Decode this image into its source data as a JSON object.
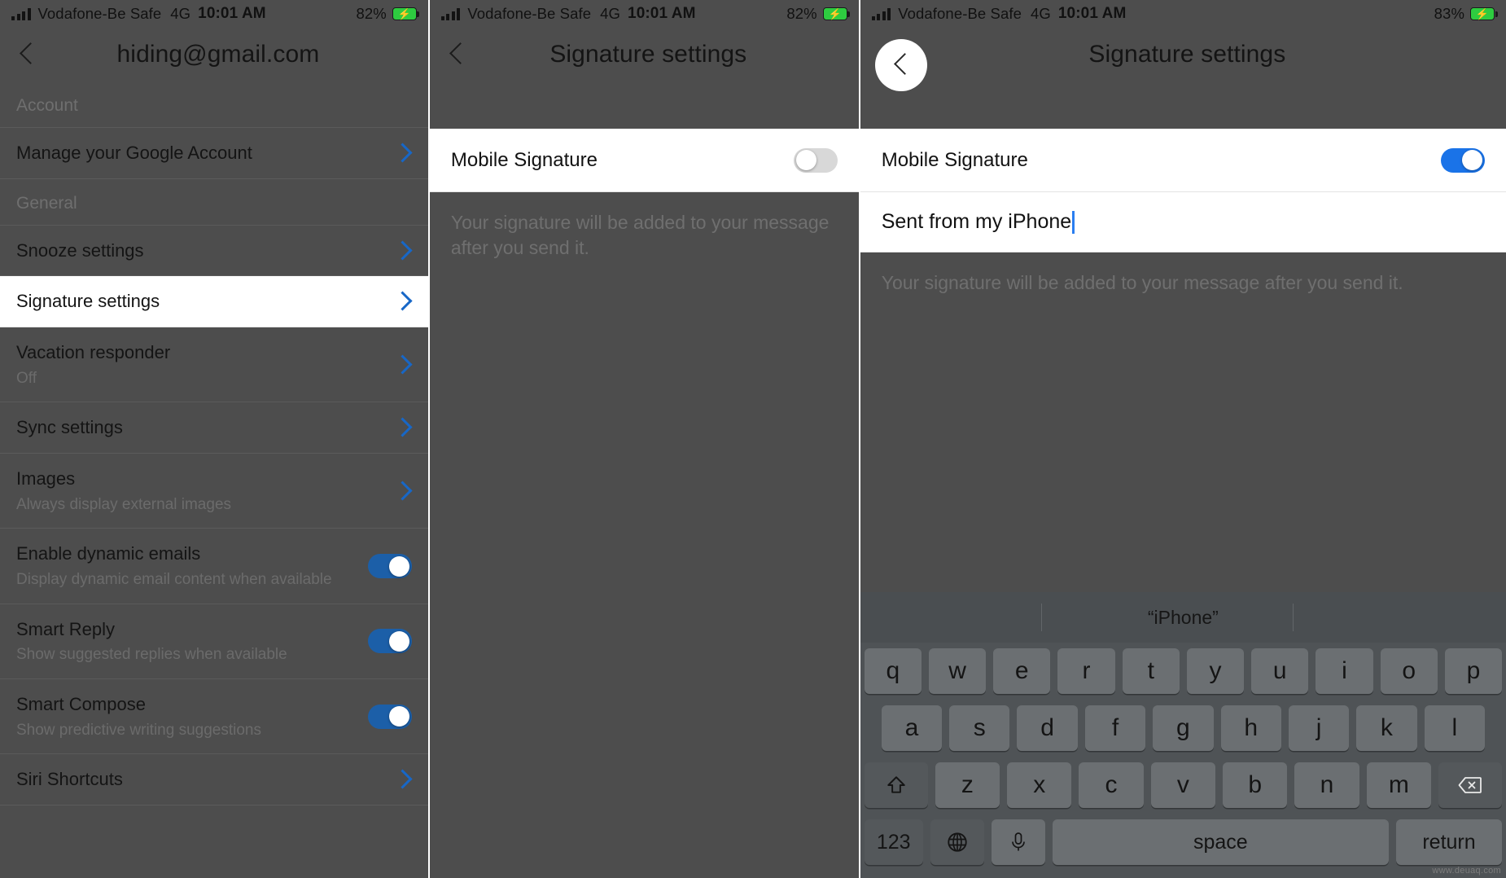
{
  "status_bar": {
    "carrier": "Vodafone-Be Safe",
    "network": "4G",
    "time": "10:01 AM",
    "battery_1": "82%",
    "battery_2": "82%",
    "battery_3": "83%",
    "signal_icon": "signal-bars-icon",
    "battery_icon": "battery-charging-icon"
  },
  "panel1": {
    "nav": {
      "back_icon": "chevron-left-icon",
      "title": "hiding@gmail.com"
    },
    "sections": [
      {
        "header": "Account",
        "rows": [
          {
            "title": "Manage your Google Account",
            "sub": "",
            "accessory": "chevron"
          }
        ]
      },
      {
        "header": "General",
        "rows": [
          {
            "title": "Snooze settings",
            "sub": "",
            "accessory": "chevron"
          },
          {
            "title": "Signature settings",
            "sub": "",
            "accessory": "chevron",
            "highlight": true
          },
          {
            "title": "Vacation responder",
            "sub": "Off",
            "accessory": "chevron"
          },
          {
            "title": "Sync settings",
            "sub": "",
            "accessory": "chevron"
          },
          {
            "title": "Images",
            "sub": "Always display external images",
            "accessory": "chevron"
          },
          {
            "title": "Enable dynamic emails",
            "sub": "Display dynamic email content when available",
            "accessory": "toggle-on"
          },
          {
            "title": "Smart Reply",
            "sub": "Show suggested replies when available",
            "accessory": "toggle-on"
          },
          {
            "title": "Smart Compose",
            "sub": "Show predictive writing suggestions",
            "accessory": "toggle-on"
          },
          {
            "title": "Siri Shortcuts",
            "sub": "",
            "accessory": "chevron"
          }
        ]
      }
    ]
  },
  "panel2": {
    "nav": {
      "back_icon": "chevron-left-icon",
      "title": "Signature settings"
    },
    "mobile_signature_label": "Mobile Signature",
    "toggle_state": "off",
    "note": "Your signature will be added to your message after you send it."
  },
  "panel3": {
    "nav": {
      "back_icon": "chevron-left-icon",
      "title": "Signature settings",
      "back_highlighted": true
    },
    "mobile_signature_label": "Mobile Signature",
    "toggle_state": "on",
    "signature_value": "Sent from my iPhone",
    "note": "Your signature will be added to your message after you send it.",
    "keyboard": {
      "suggestion": "“iPhone”",
      "row1": [
        "q",
        "w",
        "e",
        "r",
        "t",
        "y",
        "u",
        "i",
        "o",
        "p"
      ],
      "row2": [
        "a",
        "s",
        "d",
        "f",
        "g",
        "h",
        "j",
        "k",
        "l"
      ],
      "row3_shift_icon": "shift-arrow-icon",
      "row3": [
        "z",
        "x",
        "c",
        "v",
        "b",
        "n",
        "m"
      ],
      "row3_backspace_icon": "backspace-icon",
      "numbers_key": "123",
      "globe_icon": "globe-icon",
      "mic_icon": "microphone-icon",
      "space_key": "space",
      "return_key": "return"
    }
  },
  "colors": {
    "accent_blue": "#1a73e8",
    "chevron_blue": "#1767c7",
    "dim_grey": "#4d4d4d",
    "battery_green": "#2ecc40"
  },
  "watermark": "www.deuaq.com"
}
